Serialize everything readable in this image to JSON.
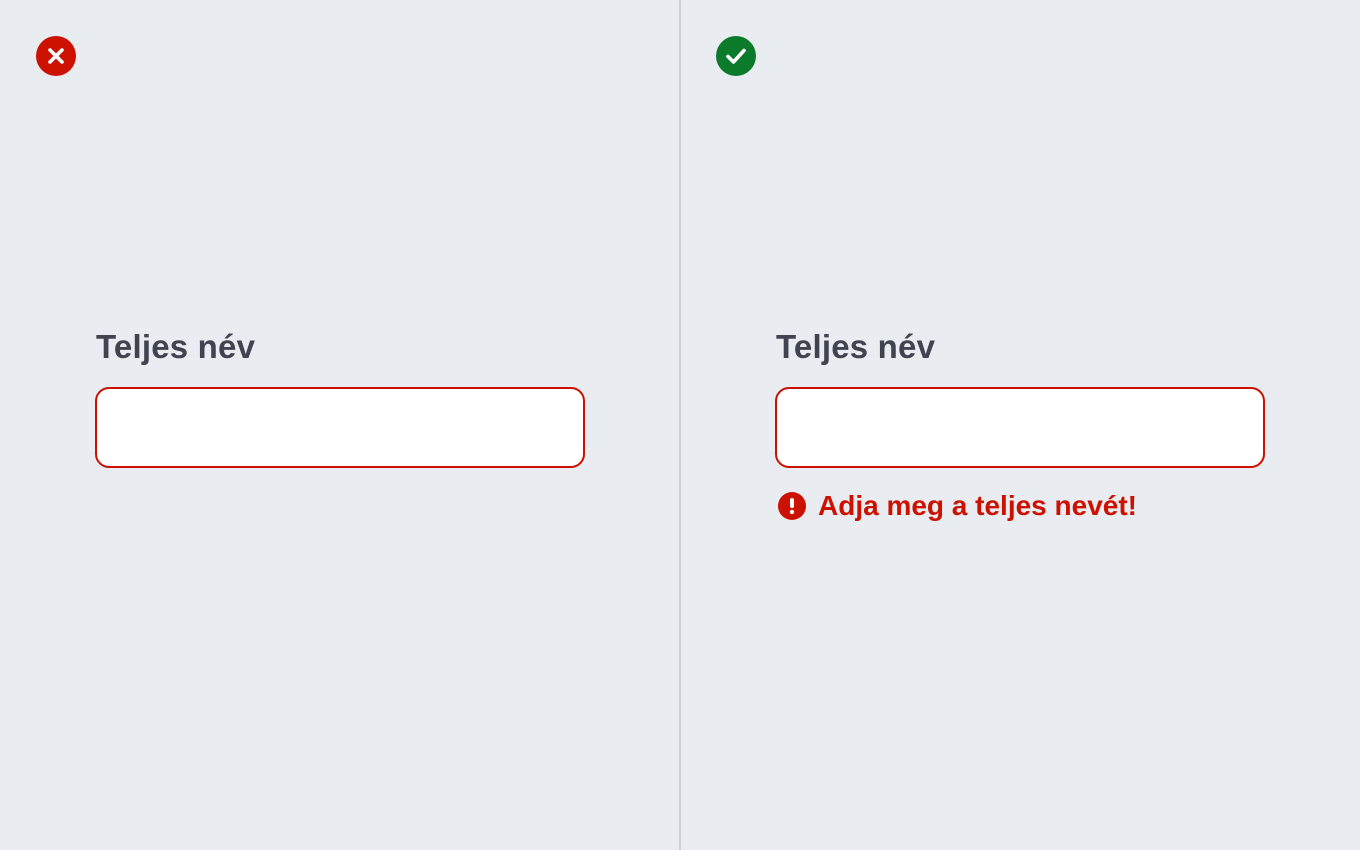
{
  "colors": {
    "background": "#e9ecf1",
    "label": "#3f4450",
    "error": "#cc1100",
    "success": "#0b7a2a",
    "divider": "#cdd1d7"
  },
  "left_panel": {
    "verdict_icon": "cross-icon",
    "verdict_color": "#cc1100",
    "field": {
      "label": "Teljes név",
      "value": "",
      "placeholder": ""
    }
  },
  "right_panel": {
    "verdict_icon": "checkmark-icon",
    "verdict_color": "#0b7a2a",
    "field": {
      "label": "Teljes név",
      "value": "",
      "placeholder": ""
    },
    "error": {
      "icon": "exclamation-icon",
      "message": "Adja meg a teljes nevét!"
    }
  }
}
